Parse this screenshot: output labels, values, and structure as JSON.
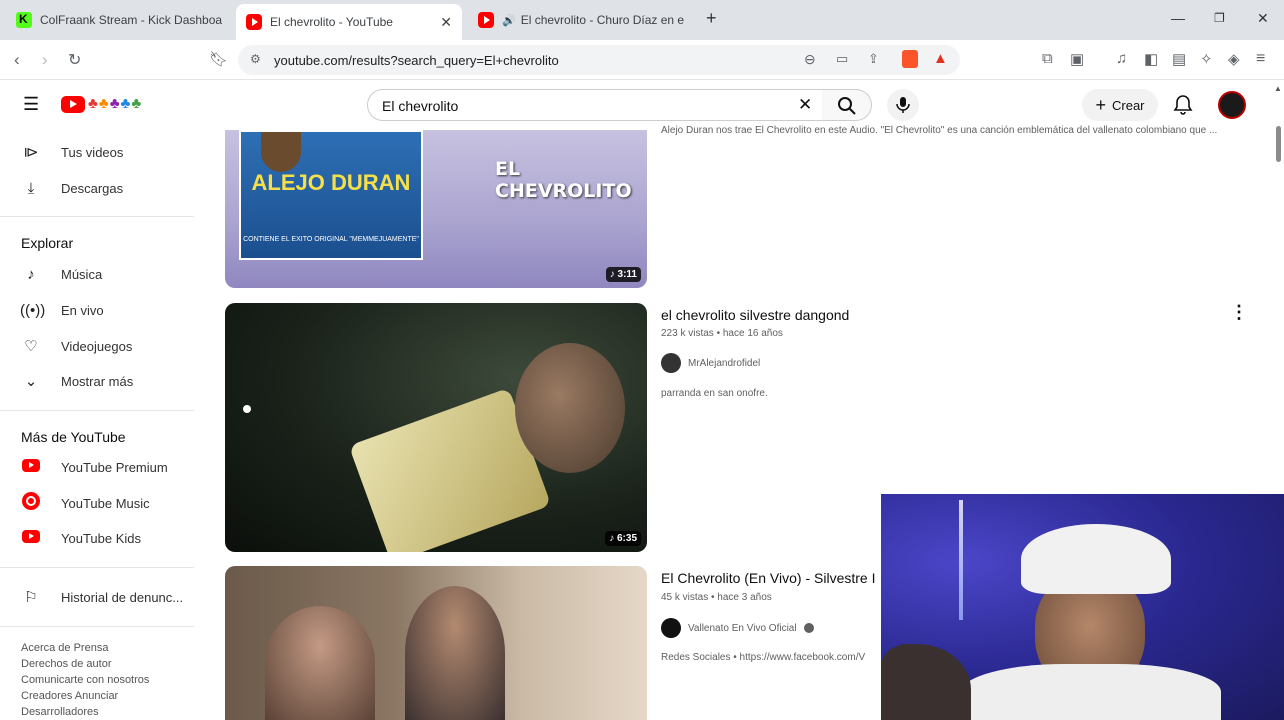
{
  "browser": {
    "tabs": [
      {
        "title": "ColFraank Stream - Kick Dashboard",
        "favicon": "kick-icon"
      },
      {
        "title": "El chevrolito - YouTube",
        "favicon": "youtube-icon",
        "active": true
      },
      {
        "title": "El chevrolito - Churo Díaz en el d",
        "favicon": "youtube-icon",
        "audio": true
      }
    ],
    "url": "youtube.com/results?search_query=El+chevrolito"
  },
  "youtube": {
    "search_value": "El chevrolito",
    "create_label": "Crear"
  },
  "sidebar": {
    "items_top": [
      {
        "label": "Tus videos",
        "icon": "play-square-icon"
      },
      {
        "label": "Descargas",
        "icon": "download-icon"
      }
    ],
    "explore_heading": "Explorar",
    "explore_items": [
      {
        "label": "Música",
        "icon": "music-note-icon"
      },
      {
        "label": "En vivo",
        "icon": "live-icon"
      },
      {
        "label": "Videojuegos",
        "icon": "gamepad-icon"
      },
      {
        "label": "Mostrar más",
        "icon": "chevron-down-icon"
      }
    ],
    "more_heading": "Más de YouTube",
    "more_items": [
      {
        "label": "YouTube Premium",
        "icon": "youtube-premium-icon"
      },
      {
        "label": "YouTube Music",
        "icon": "youtube-music-icon"
      },
      {
        "label": "YouTube Kids",
        "icon": "youtube-kids-icon"
      }
    ],
    "report_label": "Historial de denunc...",
    "footer": [
      "Acerca de  Prensa",
      "Derechos de autor",
      "Comunicarte con nosotros",
      "Creadores  Anunciar",
      "Desarrolladores"
    ]
  },
  "results": [
    {
      "thumb_text_1": "ALEJO DURAN",
      "thumb_text_2": "EL CHEVROLITO",
      "thumb_text_3": "CONTIENE EL EXITO ORIGINAL \"MEMMEJUAMENTE\"",
      "duration": "3:11",
      "description": "Alejo Duran nos trae El Chevrolito en este Audio. \"El Chevrolito\" es una canción emblemática del vallenato colombiano que ..."
    },
    {
      "title": "el chevrolito silvestre dangond",
      "meta": "223 k vistas  •  hace 16 años",
      "channel": "MrAlejandrofidel",
      "description": "parranda en san onofre.",
      "duration": "6:35"
    },
    {
      "title": "El Chevrolito (En Vivo) - Silvestre I",
      "meta": "45 k vistas  •  hace 3 años",
      "channel": "Vallenato En Vivo Oficial",
      "description": "Redes Sociales  •  https://www.facebook.com/V"
    }
  ]
}
